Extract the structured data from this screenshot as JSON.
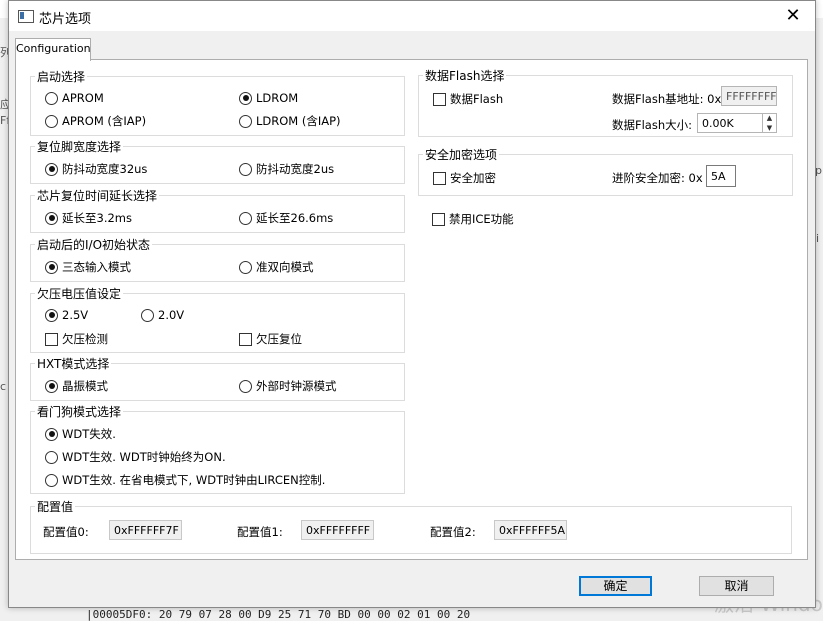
{
  "background": {
    "hex_line": "|00005DF0:  20 79 07 28 00 D9 25 71 70 BD 00 00 02 01 00 20",
    "watermark": "激活 Windo",
    "side_left": [
      "列",
      "应",
      "Ff",
      "c"
    ],
    "side_right": [
      "p",
      "i"
    ]
  },
  "dialog": {
    "title": "芯片选项",
    "close_glyph": "✕",
    "tab_label": "Configuration"
  },
  "boot": {
    "label": "启动选择",
    "aprom": "APROM",
    "ldrom": "LDROM",
    "aprom_iap": "APROM (含IAP)",
    "ldrom_iap": "LDROM (含IAP)",
    "selected": "LDROM"
  },
  "reset_pin": {
    "label": "复位脚宽度选择",
    "opt1": "防抖动宽度32us",
    "opt2": "防抖动宽度2us"
  },
  "reset_delay": {
    "label": "芯片复位时间延长选择",
    "opt1": "延长至3.2ms",
    "opt2": "延长至26.6ms"
  },
  "io_init": {
    "label": "启动后的I/O初始状态",
    "opt1": "三态输入模式",
    "opt2": "准双向模式"
  },
  "brownout": {
    "label": "欠压电压值设定",
    "v1": "2.5V",
    "v2": "2.0V",
    "detect": "欠压检测",
    "reset": "欠压复位"
  },
  "hxt": {
    "label": "HXT模式选择",
    "opt1": "晶振模式",
    "opt2": "外部时钟源模式"
  },
  "wdt": {
    "label": "看门狗模式选择",
    "opt1": "WDT失效.",
    "opt2": "WDT生效. WDT时钟始终为ON.",
    "opt3": "WDT生效. 在省电模式下, WDT时钟由LIRCEN控制."
  },
  "data_flash": {
    "label": "数据Flash选择",
    "check": "数据Flash",
    "base_label": "数据Flash基地址: 0x",
    "base_value": "FFFFFFFF",
    "size_label": "数据Flash大小:",
    "size_value": "0.00K",
    "spin_up": "▲",
    "spin_down": "▼"
  },
  "security": {
    "label": "安全加密选项",
    "check": "安全加密",
    "adv_label": "进阶安全加密: 0x",
    "adv_value": "5A"
  },
  "ice": {
    "check": "禁用ICE功能"
  },
  "config": {
    "label": "配置值",
    "c0_label": "配置值0:",
    "c0_value": "0xFFFFFF7F",
    "c1_label": "配置值1:",
    "c1_value": "0xFFFFFFFF",
    "c2_label": "配置值2:",
    "c2_value": "0xFFFFFF5A"
  },
  "buttons": {
    "ok": "确定",
    "cancel": "取消"
  }
}
